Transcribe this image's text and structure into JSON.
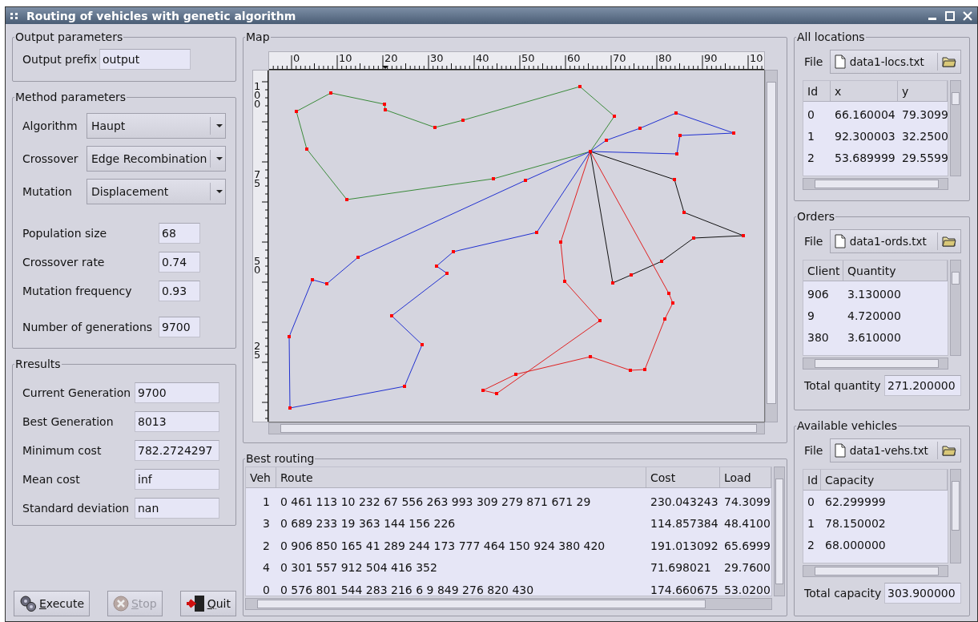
{
  "window": {
    "title": "Routing of vehicles with genetic algorithm"
  },
  "output_parameters": {
    "title": "Output parameters",
    "fields": [
      {
        "label": "Output prefix",
        "value": "output"
      }
    ]
  },
  "method_parameters": {
    "title": "Method parameters",
    "selects": [
      {
        "label": "Algorithm",
        "value": "Haupt"
      },
      {
        "label": "Crossover",
        "value": "Edge Recombination"
      },
      {
        "label": "Mutation",
        "value": "Displacement"
      }
    ],
    "fields": [
      {
        "label": "Population size",
        "value": "68"
      },
      {
        "label": "Crossover rate",
        "value": "0.74"
      },
      {
        "label": "Mutation frequency",
        "value": "0.93"
      },
      {
        "label": "Number of generations",
        "value": "9700"
      }
    ]
  },
  "results": {
    "title": "Rresults",
    "fields": [
      {
        "label": "Current Generation",
        "value": "9700"
      },
      {
        "label": "Best Generation",
        "value": "8013"
      },
      {
        "label": "Minimum cost",
        "value": "782.2724297"
      },
      {
        "label": "Mean cost",
        "value": "inf"
      },
      {
        "label": "Standard deviation",
        "value": "nan"
      }
    ]
  },
  "buttons": [
    {
      "label": "Execute",
      "kind": "execute",
      "disabled": false
    },
    {
      "label": "Stop",
      "kind": "stop",
      "disabled": true
    },
    {
      "label": "Quit",
      "kind": "quit",
      "disabled": false
    }
  ],
  "map": {
    "title": "Map",
    "x_ruler": [
      "0",
      "10",
      "20",
      "30",
      "40",
      "50",
      "60",
      "70",
      "80",
      "90",
      "10"
    ],
    "y_ruler": [
      "100",
      "75",
      "50",
      "25"
    ]
  },
  "best_routing": {
    "title": "Best routing",
    "columns": [
      "Veh",
      "Route",
      "Cost",
      "Load"
    ],
    "rows": [
      [
        "1",
        "0 461 113 10 232 67 556 263 993 309 279 871 671 29",
        "230.043243",
        "74.3099"
      ],
      [
        "3",
        "0 689 233 19 363 144 156 226",
        "114.857384",
        "48.4100"
      ],
      [
        "2",
        "0 906 850 165 41 289 244 173 777 464 150 924 380 420",
        "191.013092",
        "65.6999"
      ],
      [
        "4",
        "0 301 557 912 504 416 352",
        "71.698021",
        "29.7600"
      ],
      [
        "0",
        "0 576 801 544 283 216 6 9 849 276 820 430",
        "174.660675",
        "53.0200"
      ]
    ]
  },
  "all_locations": {
    "title": "All locations",
    "file_label": "File",
    "file": "data1-locs.txt",
    "columns": [
      "Id",
      "x",
      "y"
    ],
    "rows": [
      [
        "0",
        "66.160004",
        "79.3099"
      ],
      [
        "1",
        "92.300003",
        "32.2500"
      ],
      [
        "2",
        "53.689999",
        "29.5599"
      ]
    ]
  },
  "orders": {
    "title": "Orders",
    "file_label": "File",
    "file": "data1-ords.txt",
    "columns": [
      "Client",
      "Quantity"
    ],
    "rows": [
      [
        "906",
        "3.130000"
      ],
      [
        "9",
        "4.720000"
      ],
      [
        "380",
        "3.610000"
      ]
    ],
    "total": {
      "label": "Total quantity",
      "value": "271.200000"
    }
  },
  "available_vehicles": {
    "title": "Available vehicles",
    "file_label": "File",
    "file": "data1-vehs.txt",
    "columns": [
      "Id",
      "Capacity"
    ],
    "rows": [
      [
        "0",
        "62.299999"
      ],
      [
        "1",
        "78.150002"
      ],
      [
        "2",
        "68.000000"
      ]
    ],
    "total": {
      "label": "Total capacity",
      "value": "303.900000"
    }
  }
}
